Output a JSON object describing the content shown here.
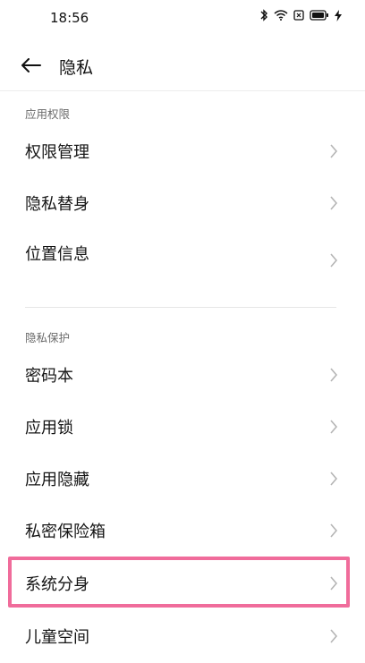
{
  "status": {
    "time": "18:56"
  },
  "header": {
    "title": "隐私"
  },
  "sections": [
    {
      "title": "应用权限",
      "items": [
        "权限管理",
        "隐私替身",
        "位置信息"
      ]
    },
    {
      "title": "隐私保护",
      "items": [
        "密码本",
        "应用锁",
        "应用隐藏",
        "私密保险箱",
        "系统分身",
        "儿童空间"
      ]
    }
  ],
  "colors": {
    "highlight": "#f06c9b"
  }
}
